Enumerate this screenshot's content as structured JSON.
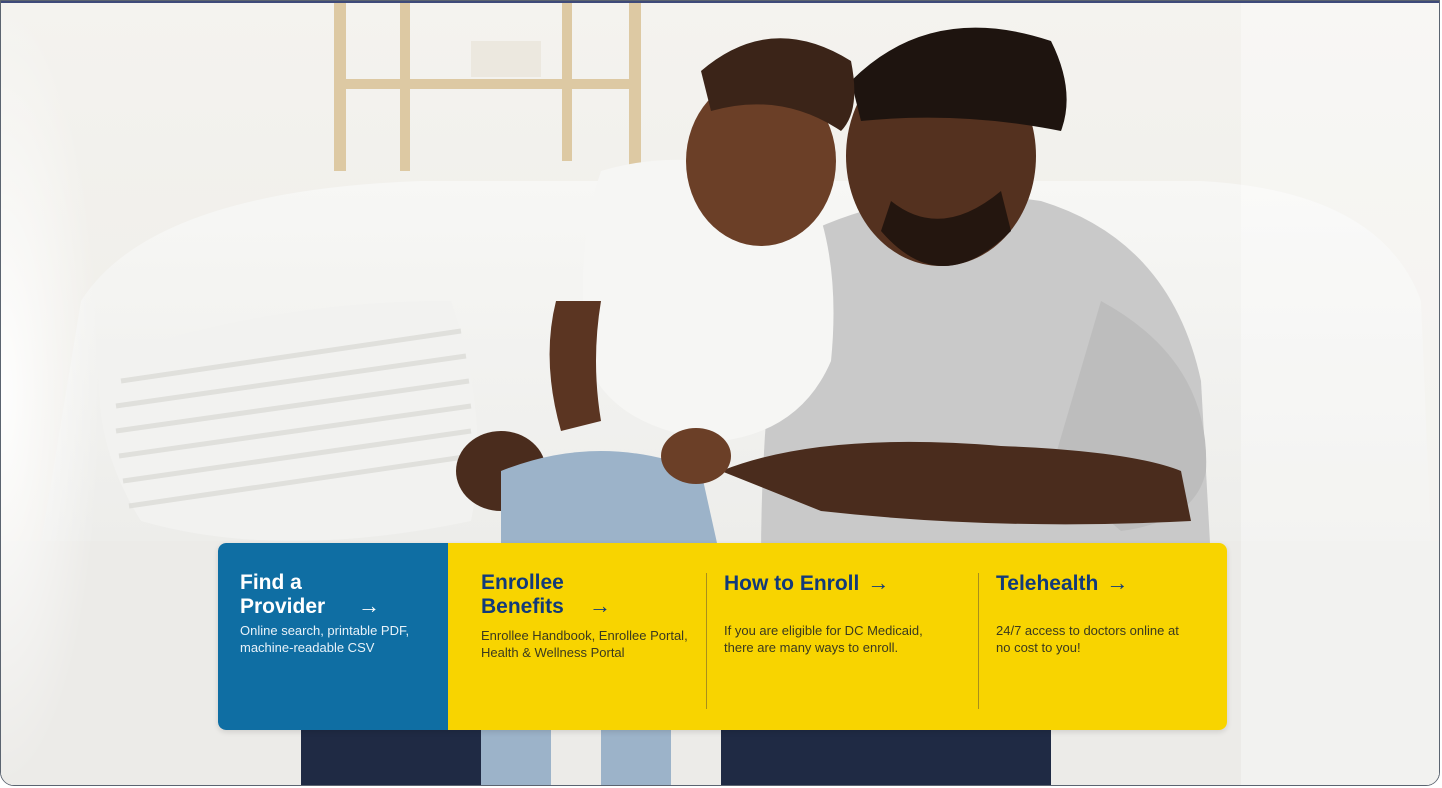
{
  "colors": {
    "provider_bg": "#0f6ea3",
    "yellow_bg": "#f8d400",
    "title_on_yellow": "#123a7a"
  },
  "hero": {
    "image_alt": "Smiling father and young daughter sitting together on a white sofa"
  },
  "cta": [
    {
      "title": "Find a Provider",
      "arrow": "→",
      "description": "Online search, printable PDF, machine-readable CSV"
    },
    {
      "title": "Enrollee Benefits",
      "arrow": "→",
      "description": "Enrollee Handbook, Enrollee Portal, Health & Wellness Portal"
    },
    {
      "title": "How to Enroll",
      "arrow": "→",
      "description": "If you are eligible for DC Medicaid, there are many ways to enroll."
    },
    {
      "title": "Telehealth",
      "arrow": "→",
      "description": "24/7 access to doctors online at no cost to you!"
    }
  ]
}
